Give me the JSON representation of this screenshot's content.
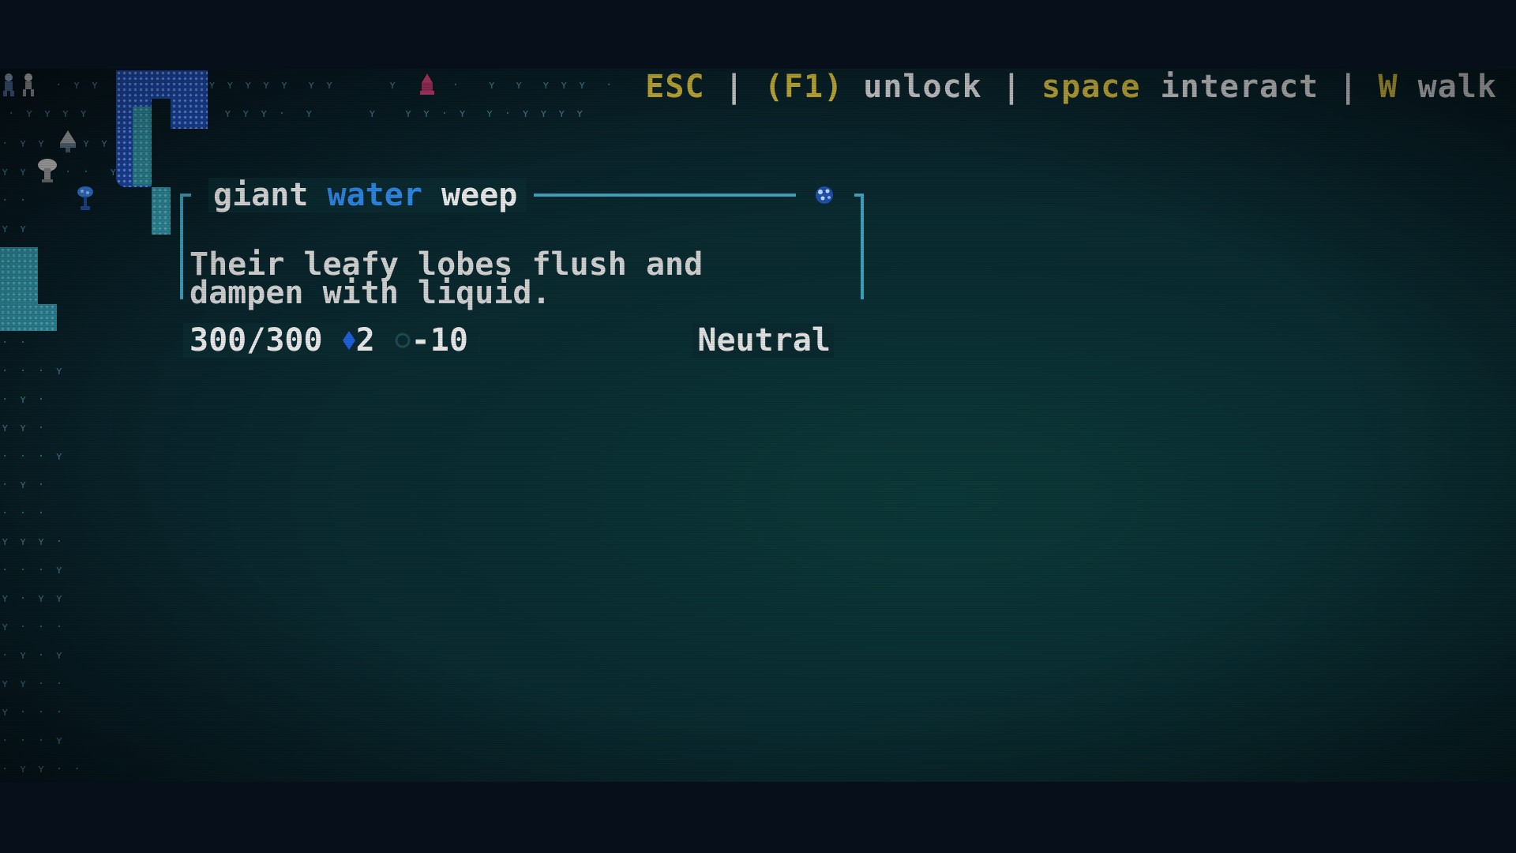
{
  "hotkeys": {
    "esc_key": "ESC",
    "separator": "|",
    "unlock_key": "(F1)",
    "unlock_action": "unlock",
    "interact_key": "space",
    "interact_action": "interact",
    "walk_key": "W",
    "walk_action": "walk"
  },
  "tooltip": {
    "title_word1": "giant",
    "title_word2": "water",
    "title_word3": "weep",
    "description": "Their leafy lobes flush and\ndampen with liquid.",
    "hitpoints": "300/300",
    "armor_icon": "diamond-icon",
    "armor_value": "2",
    "dodge_icon": "ring-icon",
    "dodge_value": "-10",
    "feeling": "Neutral",
    "icon": "water-weep-icon"
  },
  "map": {
    "grass_glyph": "ʏ",
    "sprites": [
      "player-icon",
      "tent-icon",
      "mushroom-icon",
      "water-weep-icon",
      "fire-creature-icon"
    ]
  },
  "colors": {
    "hotkey_key": "#c8b23a",
    "hotkey_text": "#cfcfcf",
    "water_word": "#2f86e4",
    "frame": "#3aa2bd",
    "deep_water": "#1c4bb0",
    "shallow_water": "#2f8da0",
    "background": "#0a2b30"
  }
}
